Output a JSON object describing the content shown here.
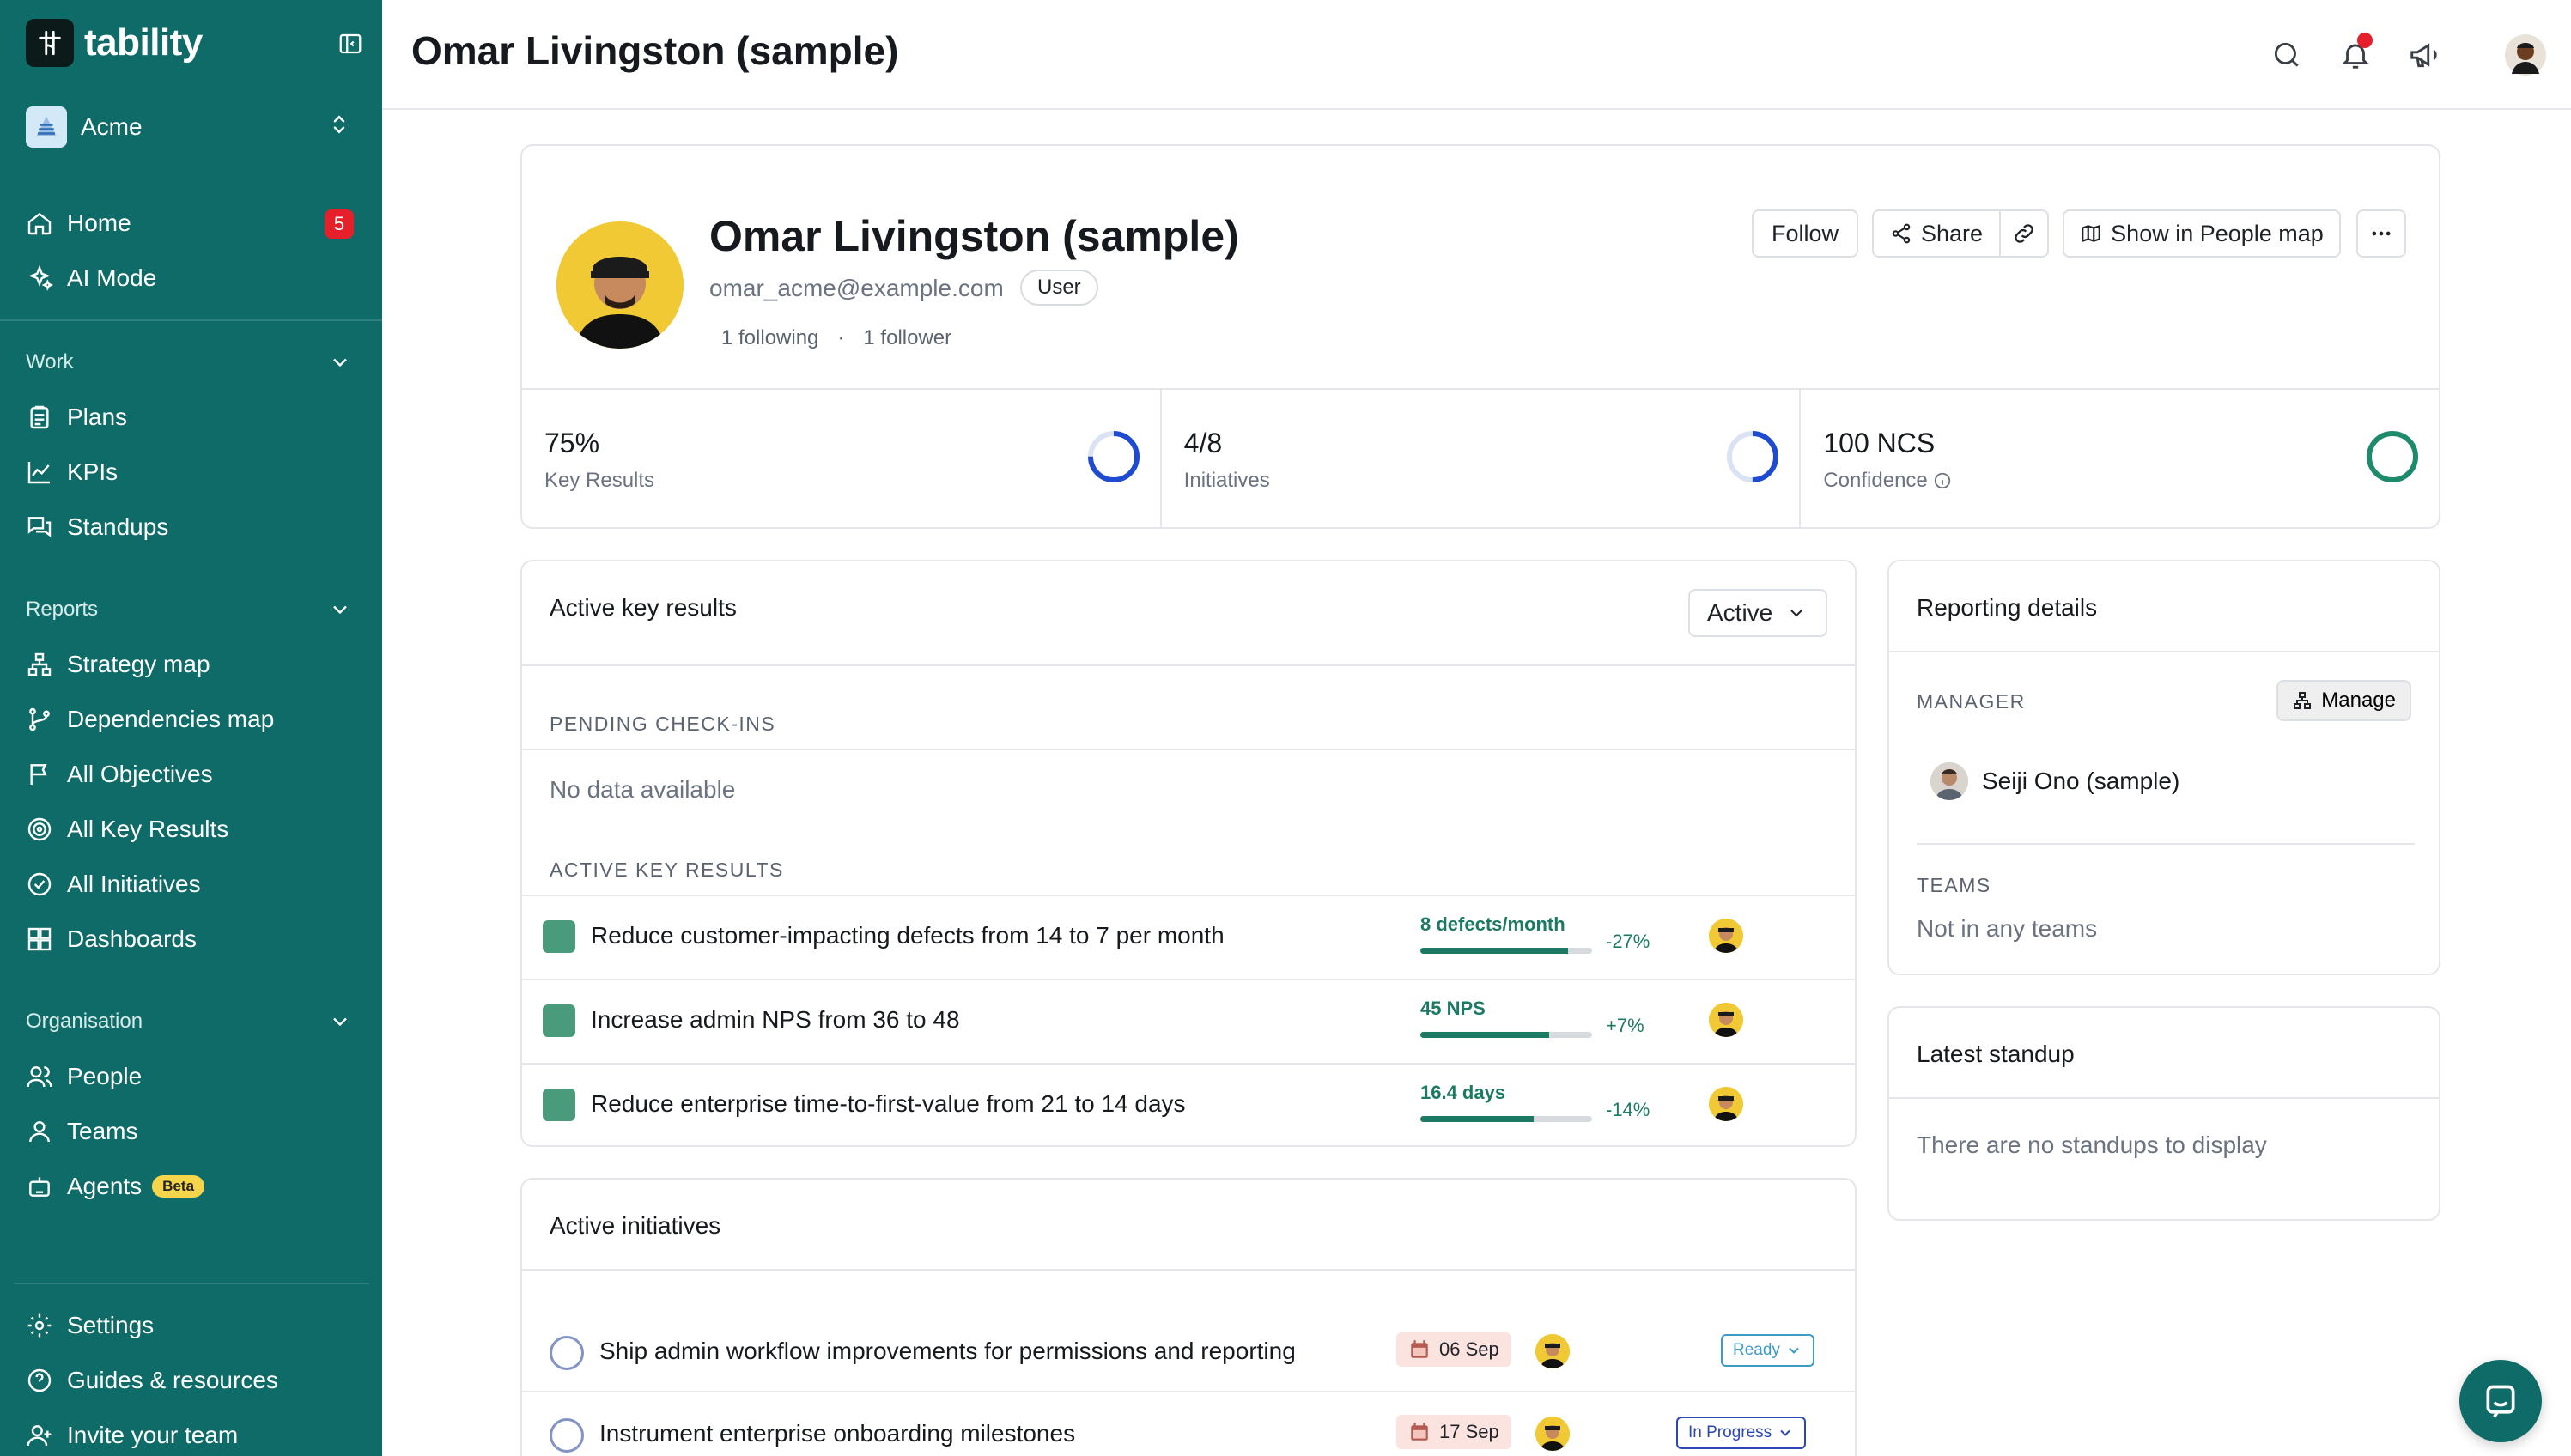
{
  "app": {
    "logo_text": "tability"
  },
  "workspace": {
    "name": "Acme"
  },
  "sidebar": {
    "home": {
      "label": "Home",
      "badge": "5"
    },
    "ai_mode": {
      "label": "AI Mode"
    },
    "work": {
      "title": "Work",
      "items": [
        "Plans",
        "KPIs",
        "Standups"
      ]
    },
    "reports": {
      "title": "Reports",
      "items": [
        "Strategy map",
        "Dependencies map",
        "All Objectives",
        "All Key Results",
        "All Initiatives",
        "Dashboards"
      ]
    },
    "organisation": {
      "title": "Organisation",
      "items": [
        "People",
        "Teams",
        "Agents"
      ],
      "agents_badge": "Beta"
    },
    "footer": [
      "Settings",
      "Guides & resources",
      "Invite your team"
    ]
  },
  "header": {
    "title": "Omar Livingston (sample)"
  },
  "profile": {
    "name": "Omar Livingston (sample)",
    "email": "omar_acme@example.com",
    "role": "User",
    "following": "1 following",
    "separator": "·",
    "followers": "1 follower",
    "buttons": {
      "follow": "Follow",
      "share": "Share",
      "people_map": "Show in People map"
    },
    "stats": [
      {
        "value": "75%",
        "label": "Key Results",
        "progress": 0.75,
        "color": "#1f4bd1"
      },
      {
        "value": "4/8",
        "label": "Initiatives",
        "progress": 0.5,
        "color": "#1f4bd1"
      },
      {
        "value": "100 NCS",
        "label": "Confidence",
        "progress": 1.0,
        "color": "#1c8a6b"
      }
    ]
  },
  "key_results": {
    "title": "Active key results",
    "filter": "Active",
    "pending_title": "PENDING CHECK-INS",
    "pending_empty": "No data available",
    "active_title": "ACTIVE KEY RESULTS",
    "items": [
      {
        "title": "Reduce customer-impacting defects from 14 to 7 per month",
        "metric": "8 defects/month",
        "progress": 0.86,
        "delta": "-27%"
      },
      {
        "title": "Increase admin NPS from 36 to 48",
        "metric": "45 NPS",
        "progress": 0.75,
        "delta": "+7%"
      },
      {
        "title": "Reduce enterprise time-to-first-value from 21 to 14 days",
        "metric": "16.4 days",
        "progress": 0.66,
        "delta": "-14%"
      }
    ]
  },
  "initiatives": {
    "title": "Active initiatives",
    "items": [
      {
        "title": "Ship admin workflow improvements for permissions and reporting",
        "date": "06 Sep",
        "status": "Ready",
        "status_color": "#3d9bc4"
      },
      {
        "title": "Instrument enterprise onboarding milestones",
        "date": "17 Sep",
        "status": "In Progress",
        "status_color": "#2b47b8"
      }
    ]
  },
  "reporting": {
    "title": "Reporting details",
    "manager_label": "MANAGER",
    "manage_button": "Manage",
    "manager_name": "Seiji Ono (sample)",
    "teams_label": "TEAMS",
    "teams_value": "Not in any teams"
  },
  "standup": {
    "title": "Latest standup",
    "empty": "There are no standups to display"
  }
}
